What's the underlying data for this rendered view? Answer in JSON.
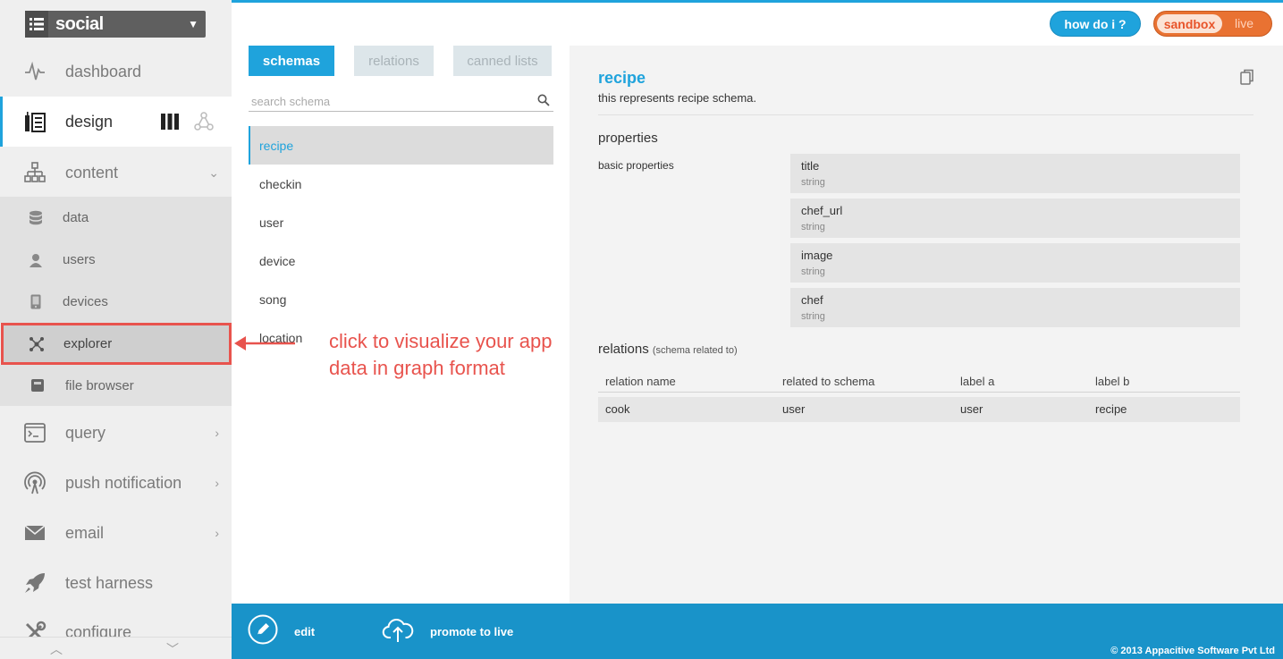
{
  "app_selector": {
    "name": "social"
  },
  "sidebar": {
    "items": [
      {
        "label": "dashboard"
      },
      {
        "label": "design"
      },
      {
        "label": "content"
      },
      {
        "label": "query"
      },
      {
        "label": "push notification"
      },
      {
        "label": "email"
      },
      {
        "label": "test harness"
      },
      {
        "label": "configure"
      }
    ],
    "content_sub": [
      {
        "label": "data"
      },
      {
        "label": "users"
      },
      {
        "label": "devices"
      },
      {
        "label": "explorer"
      },
      {
        "label": "file browser"
      }
    ]
  },
  "tabs": [
    {
      "label": "schemas",
      "active": true
    },
    {
      "label": "relations"
    },
    {
      "label": "canned lists"
    }
  ],
  "search": {
    "placeholder": "search schema"
  },
  "schemas": [
    "recipe",
    "checkin",
    "user",
    "device",
    "song",
    "location"
  ],
  "annotation": {
    "text": "click to visualize your app data in graph format"
  },
  "detail": {
    "title": "recipe",
    "description": "this represents recipe schema.",
    "properties_heading": "properties",
    "basic_label": "basic properties",
    "properties": [
      {
        "name": "title",
        "type": "string"
      },
      {
        "name": "chef_url",
        "type": "string"
      },
      {
        "name": "image",
        "type": "string"
      },
      {
        "name": "chef",
        "type": "string"
      }
    ],
    "relations_heading": "relations",
    "relations_sub": "(schema related to)",
    "relation_columns": [
      "relation name",
      "related to schema",
      "label a",
      "label b"
    ],
    "relation_rows": [
      [
        "cook",
        "user",
        "user",
        "recipe"
      ]
    ]
  },
  "header": {
    "help_label": "how do i ?",
    "env_sandbox": "sandbox",
    "env_live": "live"
  },
  "bottombar": {
    "edit_label": "edit",
    "promote_label": "promote to live",
    "copyright": "© 2013 Appacitive Software Pvt Ltd"
  },
  "colors": {
    "accent": "#1fa3dc",
    "annotation": "#e8534d",
    "env": "#e97232"
  }
}
